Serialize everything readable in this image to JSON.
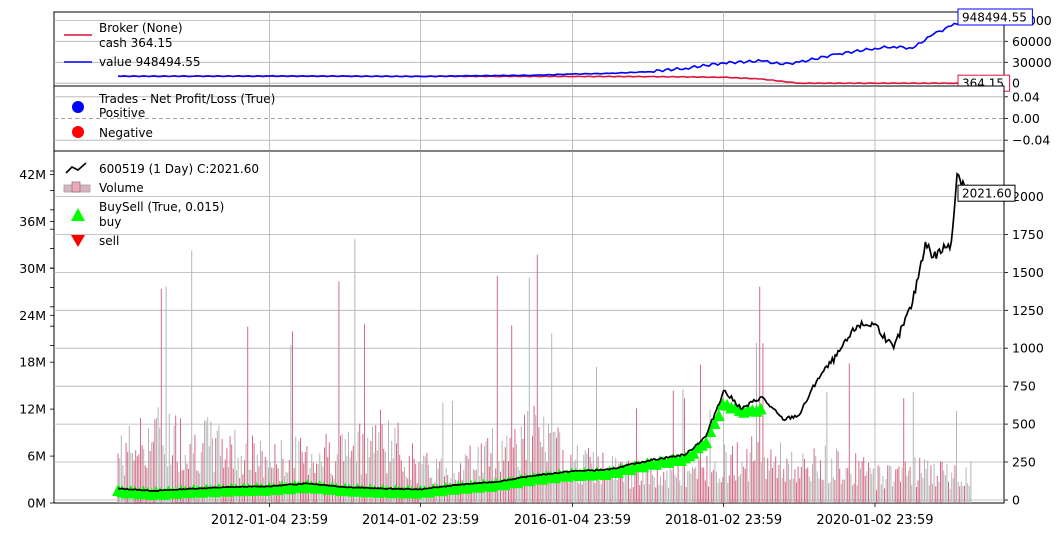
{
  "chart_data": [
    {
      "type": "line",
      "panel": "broker",
      "series": [
        {
          "name": "cash",
          "color": "#dc143c",
          "x": [
            "2010-01-04",
            "2011-01-04",
            "2012-01-04",
            "2013-01-04",
            "2014-01-02",
            "2015-01-05",
            "2016-01-04",
            "2017-01-03",
            "2018-01-02",
            "2018-07-02",
            "2019-01-02",
            "2020-01-02",
            "2021-01-04",
            "2021-04-12"
          ],
          "values": [
            100000,
            100000,
            99500,
            99000,
            98500,
            98000,
            97000,
            95000,
            85000,
            60000,
            364.15,
            364.15,
            364.15,
            364.15
          ]
        },
        {
          "name": "value",
          "color": "#0000ff",
          "x": [
            "2010-01-04",
            "2011-01-04",
            "2012-01-04",
            "2013-01-04",
            "2014-01-02",
            "2014-07-01",
            "2015-01-05",
            "2015-07-01",
            "2016-01-04",
            "2016-07-01",
            "2017-01-03",
            "2017-07-03",
            "2018-01-02",
            "2018-07-02",
            "2018-10-15",
            "2019-01-02",
            "2019-07-01",
            "2020-01-02",
            "2020-04-01",
            "2020-07-01",
            "2020-10-09",
            "2021-01-04",
            "2021-04-12"
          ],
          "values": [
            100000,
            101000,
            103000,
            102000,
            96000,
            104000,
            110000,
            114000,
            131000,
            140000,
            165000,
            215000,
            290000,
            320000,
            270000,
            302000,
            415000,
            500000,
            525000,
            500000,
            700000,
            820000,
            948494.55
          ]
        }
      ],
      "legend_title": "Broker (None)",
      "legend": [
        {
          "label": "cash 364.15",
          "color": "#dc143c"
        },
        {
          "label": "value 948494.55",
          "color": "#0000ff"
        }
      ],
      "last_labels": [
        {
          "text": "948494.55",
          "color": "#0000ff"
        },
        {
          "text": "364.15",
          "color": "#dc143c"
        }
      ],
      "yticks": [
        "60000",
        "30000",
        "0"
      ],
      "ytick_values": [
        600000,
        300000,
        0
      ],
      "yclip_label": "90000",
      "yclip_value": 900000,
      "ylim": [
        -40000,
        1020000
      ]
    },
    {
      "type": "scatter",
      "panel": "trades",
      "legend_title": "Trades - Net Profit/Loss (True)",
      "legend": [
        {
          "label": "Positive",
          "color": "#0000ff"
        },
        {
          "label": "Negative",
          "color": "#ff0000"
        }
      ],
      "x": [],
      "values": [],
      "yticks": [
        "0.04",
        "0.00",
        "−0.04"
      ],
      "ytick_values": [
        0.04,
        0.0,
        -0.04
      ],
      "ylim": [
        -0.06,
        0.06
      ]
    },
    {
      "type": "line",
      "panel": "price",
      "legend": [
        {
          "label": "600519 (1 Day) C:2021.60",
          "color": "#000000"
        },
        {
          "label": "Volume",
          "color": "#e8a0b0"
        },
        {
          "label": "BuySell (True, 0.015)",
          "color": "#00ff00"
        },
        {
          "label": "buy",
          "color": "#00ff00"
        },
        {
          "label": "sell",
          "color": "#ff0000"
        }
      ],
      "close": {
        "name": "600519 (1 Day) C:2021.60",
        "x": [
          "2010-01-04",
          "2010-07-01",
          "2011-01-04",
          "2011-07-01",
          "2012-01-04",
          "2012-07-02",
          "2013-01-04",
          "2013-07-01",
          "2014-01-02",
          "2014-07-01",
          "2015-01-05",
          "2015-07-01",
          "2016-01-04",
          "2016-07-01",
          "2017-01-03",
          "2017-07-03",
          "2017-10-09",
          "2018-01-02",
          "2018-04-02",
          "2018-07-02",
          "2018-10-15",
          "2019-01-02",
          "2019-04-01",
          "2019-07-01",
          "2019-10-08",
          "2020-01-02",
          "2020-03-02",
          "2020-04-01",
          "2020-07-01",
          "2020-09-01",
          "2020-10-09",
          "2021-01-04",
          "2021-02-01",
          "2021-04-12"
        ],
        "values": [
          75,
          60,
          75,
          85,
          90,
          110,
          85,
          75,
          70,
          100,
          120,
          160,
          190,
          200,
          260,
          300,
          420,
          720,
          600,
          680,
          530,
          560,
          800,
          950,
          1150,
          1160,
          1050,
          1000,
          1300,
          1700,
          1600,
          1700,
          2150,
          2021.6
        ]
      },
      "buy_markers": {
        "x": [
          "2010-01-04",
          "2010-07-01",
          "2011-01-04",
          "2011-07-01",
          "2012-01-04",
          "2012-07-02",
          "2013-01-04",
          "2013-07-01",
          "2014-01-02",
          "2014-07-01",
          "2015-01-05",
          "2015-07-01",
          "2016-01-04",
          "2016-07-01",
          "2017-01-03",
          "2017-07-03",
          "2017-10-09",
          "2018-01-02",
          "2018-04-02",
          "2018-07-02"
        ],
        "values": [
          72,
          58,
          72,
          82,
          87,
          106,
          82,
          72,
          67,
          96,
          115,
          154,
          182,
          192,
          250,
          288,
          400,
          650,
          600,
          610
        ]
      },
      "sell_markers": {
        "x": [],
        "values": []
      },
      "last_label": "2021.60",
      "yticks": [
        "2000",
        "1750",
        "1500",
        "1250",
        "1000",
        "750",
        "500",
        "250",
        "0"
      ],
      "ytick_values": [
        2000,
        1750,
        1500,
        1250,
        1000,
        750,
        500,
        250,
        0
      ],
      "ylim": [
        -20,
        2300
      ],
      "volume": {
        "name": "Volume",
        "yticks": [
          "42M",
          "36M",
          "30M",
          "24M",
          "18M",
          "12M",
          "6M",
          "0M"
        ],
        "ytick_values": [
          42,
          36,
          30,
          24,
          18,
          12,
          6,
          0
        ],
        "unit": "M",
        "ylim": [
          0,
          45
        ],
        "x": [
          "2010-01-04",
          "2010-07-01",
          "2011-01-04",
          "2011-07-01",
          "2012-01-04",
          "2012-07-02",
          "2013-01-04",
          "2013-07-01",
          "2014-01-02",
          "2014-07-01",
          "2015-01-05",
          "2015-07-01",
          "2016-01-04",
          "2016-07-01",
          "2017-01-03",
          "2017-07-03",
          "2018-01-02",
          "2018-07-02",
          "2019-01-02",
          "2019-07-01",
          "2020-01-02",
          "2020-07-01",
          "2021-01-04",
          "2021-04-12"
        ],
        "values": [
          7,
          10,
          9,
          8,
          6,
          7,
          8,
          10,
          5,
          5,
          8,
          10,
          6,
          5,
          4,
          4,
          6,
          7,
          5,
          6,
          4,
          5,
          4,
          5
        ]
      }
    }
  ],
  "xaxis": {
    "ticks": [
      "2012-01-04 23:59",
      "2014-01-02 23:59",
      "2016-01-04 23:59",
      "2018-01-02 23:59",
      "2020-01-02 23:59"
    ],
    "tick_dates": [
      "2012-01-04",
      "2014-01-02",
      "2016-01-04",
      "2018-01-02",
      "2020-01-02"
    ],
    "range": [
      "2009-03-01",
      "2021-09-15"
    ]
  }
}
